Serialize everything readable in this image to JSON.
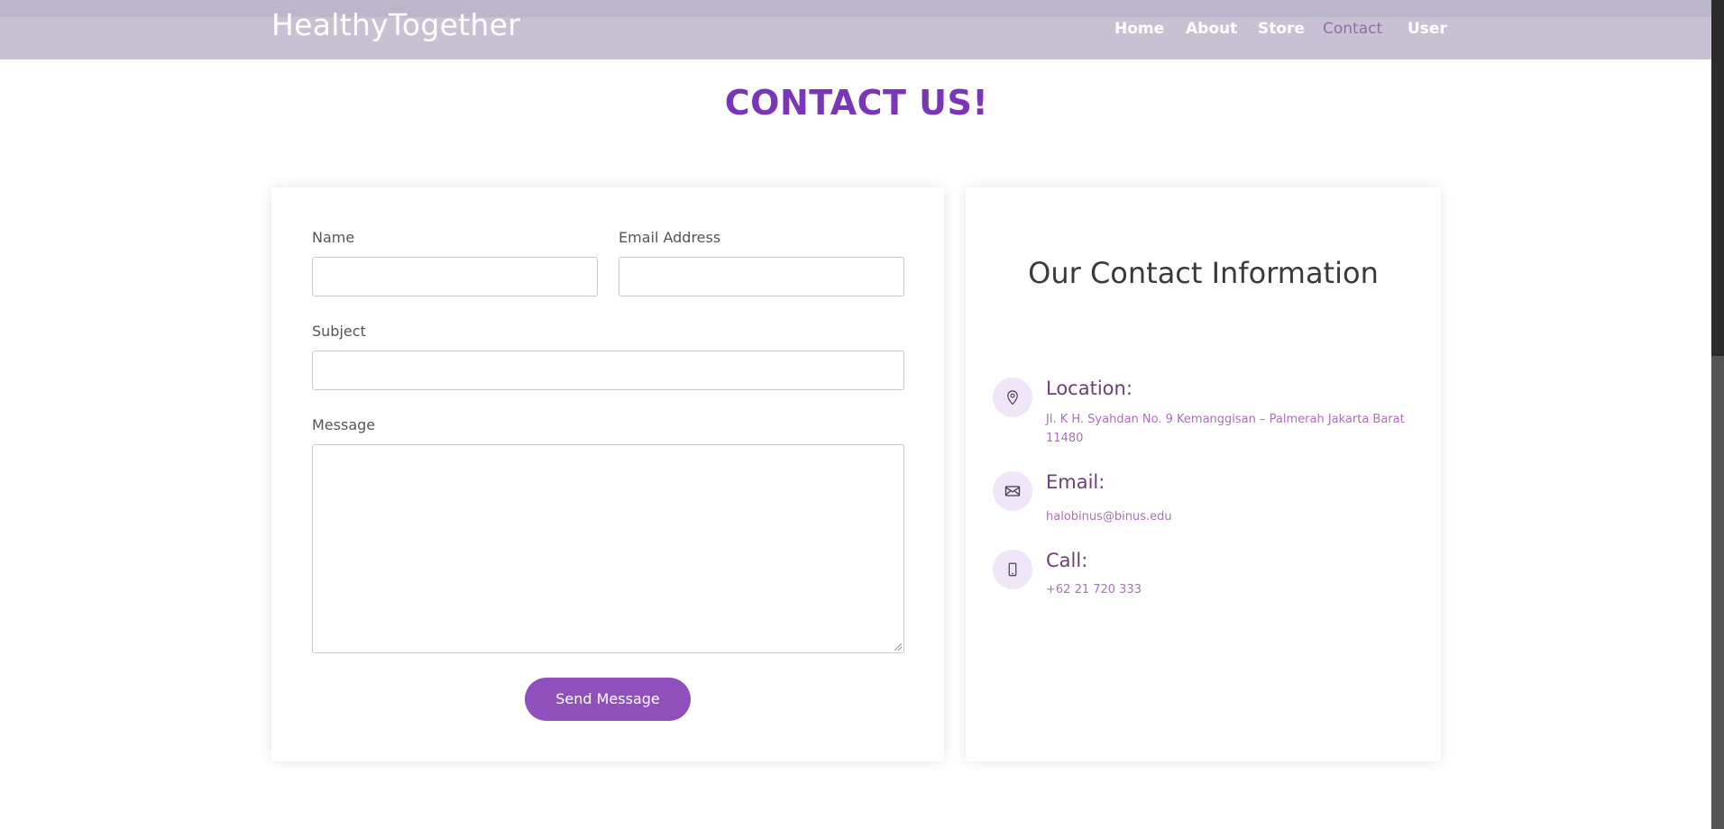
{
  "navbar": {
    "brand": "HealthyTogether",
    "links": [
      {
        "label": "Home",
        "active": false
      },
      {
        "label": "About",
        "active": false
      },
      {
        "label": "Store",
        "active": false
      },
      {
        "label": "Contact",
        "active": true
      },
      {
        "label": "User",
        "active": false
      }
    ]
  },
  "page": {
    "title": "CONTACT US!"
  },
  "form": {
    "name_label": "Name",
    "name_value": "",
    "email_label": "Email Address",
    "email_value": "",
    "subject_label": "Subject",
    "subject_value": "",
    "message_label": "Message",
    "message_value": "",
    "submit_label": "Send Message"
  },
  "contact_info": {
    "title": "Our Contact Information",
    "items": [
      {
        "icon": "map-pin-icon",
        "heading": "Location:",
        "text": "Jl. K H. Syahdan No. 9 Kemanggisan – Palmerah Jakarta Barat 11480"
      },
      {
        "icon": "envelope-icon",
        "heading": "Email:",
        "text": "halobinus@binus.edu"
      },
      {
        "icon": "phone-icon",
        "heading": "Call:",
        "text": "+62 21 720 333"
      }
    ]
  },
  "colors": {
    "navbar_bg": "#c7c1d3",
    "title": "#7b35b8",
    "button": "#8f4fbd",
    "nav_active": "#9a6aa8",
    "info_heading": "#6b3f78",
    "info_text": "#a872b4",
    "icon_bg": "#f1e6f7"
  }
}
